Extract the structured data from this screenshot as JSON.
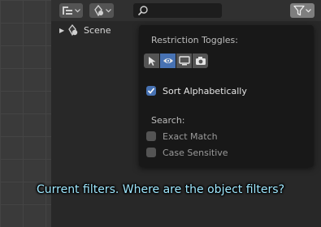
{
  "outliner": {
    "tree": {
      "scene_label": "Scene"
    },
    "icons": {
      "display_mode": "display-mode-icon",
      "filter_object": "object-type-icon",
      "search": "search-icon",
      "filter": "filter-icon"
    }
  },
  "filter_popup": {
    "restriction_heading": "Restriction Toggles:",
    "restriction_toggles": [
      {
        "name": "select-toggle",
        "icon": "cursor-icon",
        "active": false
      },
      {
        "name": "visibility-toggle",
        "icon": "eye-icon",
        "active": true
      },
      {
        "name": "viewport-toggle",
        "icon": "monitor-icon",
        "active": false
      },
      {
        "name": "render-toggle",
        "icon": "camera-icon",
        "active": false
      }
    ],
    "sort_alphabetically": {
      "label": "Sort Alphabetically",
      "checked": true
    },
    "search_heading": "Search:",
    "exact_match": {
      "label": "Exact Match",
      "checked": false
    },
    "case_sensitive": {
      "label": "Case Sensitive",
      "checked": false
    }
  },
  "caption": "Current filters. Where are the object filters?",
  "colors": {
    "accent": "#4772b3",
    "caption": "#9fe8ff"
  }
}
